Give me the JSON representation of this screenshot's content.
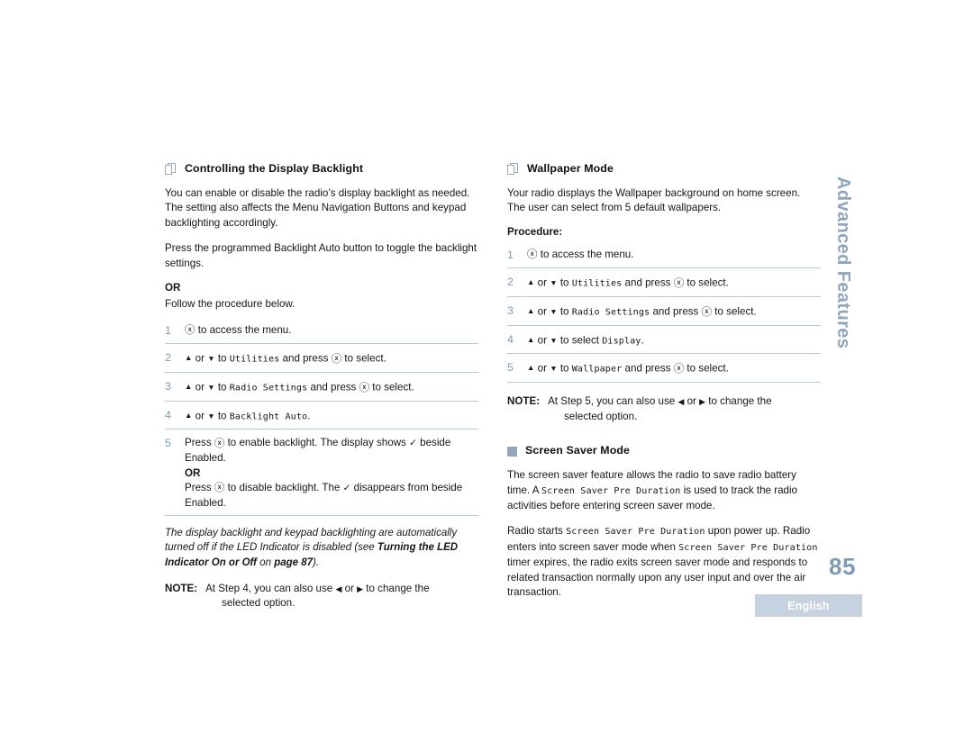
{
  "document": {
    "page_number": "85",
    "language_badge": "English",
    "side_tab": "Advanced Features",
    "accent_color": "#7d9ab8",
    "rule_color": "#b9c9d6",
    "badge_bg": "#c7d2e0"
  },
  "left_column": {
    "heading": "Controlling the Display Backlight",
    "heading_icon": "pages-icon",
    "paragraphs": [
      "You can enable or disable the radio’s display backlight as needed. The setting also affects the Menu Navigation Buttons and keypad backlighting accordingly.",
      "Press the programmed Backlight Auto button to toggle the backlight settings.",
      "Follow the procedure below."
    ],
    "or_label": "OR",
    "steps": [
      {
        "num": "1",
        "parts": [
          {
            "type": "icon",
            "icon": "menu-button-icon"
          },
          {
            "type": "text",
            "text": " to access the menu."
          }
        ]
      },
      {
        "num": "2",
        "parts": [
          {
            "type": "icon",
            "icon": "up-arrow-icon"
          },
          {
            "type": "text",
            "text": " or "
          },
          {
            "type": "icon",
            "icon": "down-arrow-icon"
          },
          {
            "type": "text",
            "text": " to "
          },
          {
            "type": "mono",
            "text": "Utilities"
          },
          {
            "type": "text",
            "text": " and press "
          },
          {
            "type": "icon",
            "icon": "menu-button-icon"
          },
          {
            "type": "text",
            "text": " to select."
          }
        ]
      },
      {
        "num": "3",
        "parts": [
          {
            "type": "icon",
            "icon": "up-arrow-icon"
          },
          {
            "type": "text",
            "text": " or "
          },
          {
            "type": "icon",
            "icon": "down-arrow-icon"
          },
          {
            "type": "text",
            "text": " to "
          },
          {
            "type": "mono",
            "text": "Radio Settings"
          },
          {
            "type": "text",
            "text": " and press "
          },
          {
            "type": "icon",
            "icon": "menu-button-icon"
          },
          {
            "type": "text",
            "text": " to select."
          }
        ]
      },
      {
        "num": "4",
        "parts": [
          {
            "type": "icon",
            "icon": "up-arrow-icon"
          },
          {
            "type": "text",
            "text": " or "
          },
          {
            "type": "icon",
            "icon": "down-arrow-icon"
          },
          {
            "type": "text",
            "text": " to "
          },
          {
            "type": "mono",
            "text": "Backlight Auto"
          },
          {
            "type": "text",
            "text": "."
          }
        ]
      },
      {
        "num": "5",
        "lines": [
          {
            "parts": [
              {
                "type": "text",
                "text": "Press "
              },
              {
                "type": "icon",
                "icon": "menu-button-icon"
              },
              {
                "type": "text",
                "text": " to enable backlight. The display shows "
              },
              {
                "type": "icon",
                "icon": "check-icon"
              },
              {
                "type": "text",
                "text": " beside Enabled."
              }
            ]
          },
          {
            "or": "OR"
          },
          {
            "parts": [
              {
                "type": "text",
                "text": "Press "
              },
              {
                "type": "icon",
                "icon": "menu-button-icon"
              },
              {
                "type": "text",
                "text": " to disable backlight. The "
              },
              {
                "type": "icon",
                "icon": "check-icon"
              },
              {
                "type": "text",
                "text": " disappears from beside Enabled."
              }
            ]
          }
        ]
      }
    ],
    "italic_note": {
      "text_1": "The display backlight and keypad backlighting are automatically turned off if the LED Indicator is disabled (see ",
      "bold_1": "Turning the LED Indicator On or Off",
      "text_2": " on ",
      "bold_2": "page 87",
      "text_3": ")."
    },
    "note": {
      "label": "NOTE:",
      "line_1_a": "At Step 4, you can also use ",
      "line_1_b": " or ",
      "line_1_c": " to change the",
      "line_2": "selected option."
    }
  },
  "right_column": {
    "heading": "Wallpaper Mode",
    "heading_icon": "pages-icon",
    "paragraph": "Your radio displays the Wallpaper background on home screen. The user can select from 5 default wallpapers.",
    "procedure_label": "Procedure:",
    "steps": [
      {
        "num": "1",
        "parts": [
          {
            "type": "icon",
            "icon": "menu-button-icon"
          },
          {
            "type": "text",
            "text": " to access the menu."
          }
        ]
      },
      {
        "num": "2",
        "parts": [
          {
            "type": "icon",
            "icon": "up-arrow-icon"
          },
          {
            "type": "text",
            "text": " or "
          },
          {
            "type": "icon",
            "icon": "down-arrow-icon"
          },
          {
            "type": "text",
            "text": " to "
          },
          {
            "type": "mono",
            "text": "Utilities"
          },
          {
            "type": "text",
            "text": " and press "
          },
          {
            "type": "icon",
            "icon": "menu-button-icon"
          },
          {
            "type": "text",
            "text": " to select."
          }
        ]
      },
      {
        "num": "3",
        "parts": [
          {
            "type": "icon",
            "icon": "up-arrow-icon"
          },
          {
            "type": "text",
            "text": " or "
          },
          {
            "type": "icon",
            "icon": "down-arrow-icon"
          },
          {
            "type": "text",
            "text": " to "
          },
          {
            "type": "mono",
            "text": "Radio Settings"
          },
          {
            "type": "text",
            "text": " and press "
          },
          {
            "type": "icon",
            "icon": "menu-button-icon"
          },
          {
            "type": "text",
            "text": " to select."
          }
        ]
      },
      {
        "num": "4",
        "parts": [
          {
            "type": "icon",
            "icon": "up-arrow-icon"
          },
          {
            "type": "text",
            "text": " or "
          },
          {
            "type": "icon",
            "icon": "down-arrow-icon"
          },
          {
            "type": "text",
            "text": " to select "
          },
          {
            "type": "mono",
            "text": "Display"
          },
          {
            "type": "text",
            "text": "."
          }
        ]
      },
      {
        "num": "5",
        "parts": [
          {
            "type": "icon",
            "icon": "up-arrow-icon"
          },
          {
            "type": "text",
            "text": " or "
          },
          {
            "type": "icon",
            "icon": "down-arrow-icon"
          },
          {
            "type": "text",
            "text": " to "
          },
          {
            "type": "mono",
            "text": "Wallpaper"
          },
          {
            "type": "text",
            "text": " and press "
          },
          {
            "type": "icon",
            "icon": "menu-button-icon"
          },
          {
            "type": "text",
            "text": " to select."
          }
        ]
      }
    ],
    "note": {
      "label": "NOTE:",
      "line_1_a": "At Step 5, you can also use ",
      "line_1_b": " or ",
      "line_1_c": " to change the",
      "line_2": "selected option."
    },
    "screen_saver": {
      "heading": "Screen Saver Mode",
      "heading_icon": "filled-square-icon",
      "para_1": [
        {
          "type": "text",
          "text": "The screen saver feature allows the radio to save radio battery time. A "
        },
        {
          "type": "mono",
          "text": "Screen Saver Pre Duration"
        },
        {
          "type": "text",
          "text": " is used to track the radio activities before entering screen saver mode."
        }
      ],
      "para_2": [
        {
          "type": "text",
          "text": "Radio starts "
        },
        {
          "type": "mono",
          "text": "Screen Saver Pre Duration"
        },
        {
          "type": "text",
          "text": " upon power up. Radio enters into screen saver mode when "
        },
        {
          "type": "mono",
          "text": "Screen Saver Pre Duration"
        },
        {
          "type": "text",
          "text": " timer expires, the radio exits screen saver mode and responds to related transaction normally upon any user input and over the air transaction."
        }
      ]
    }
  }
}
